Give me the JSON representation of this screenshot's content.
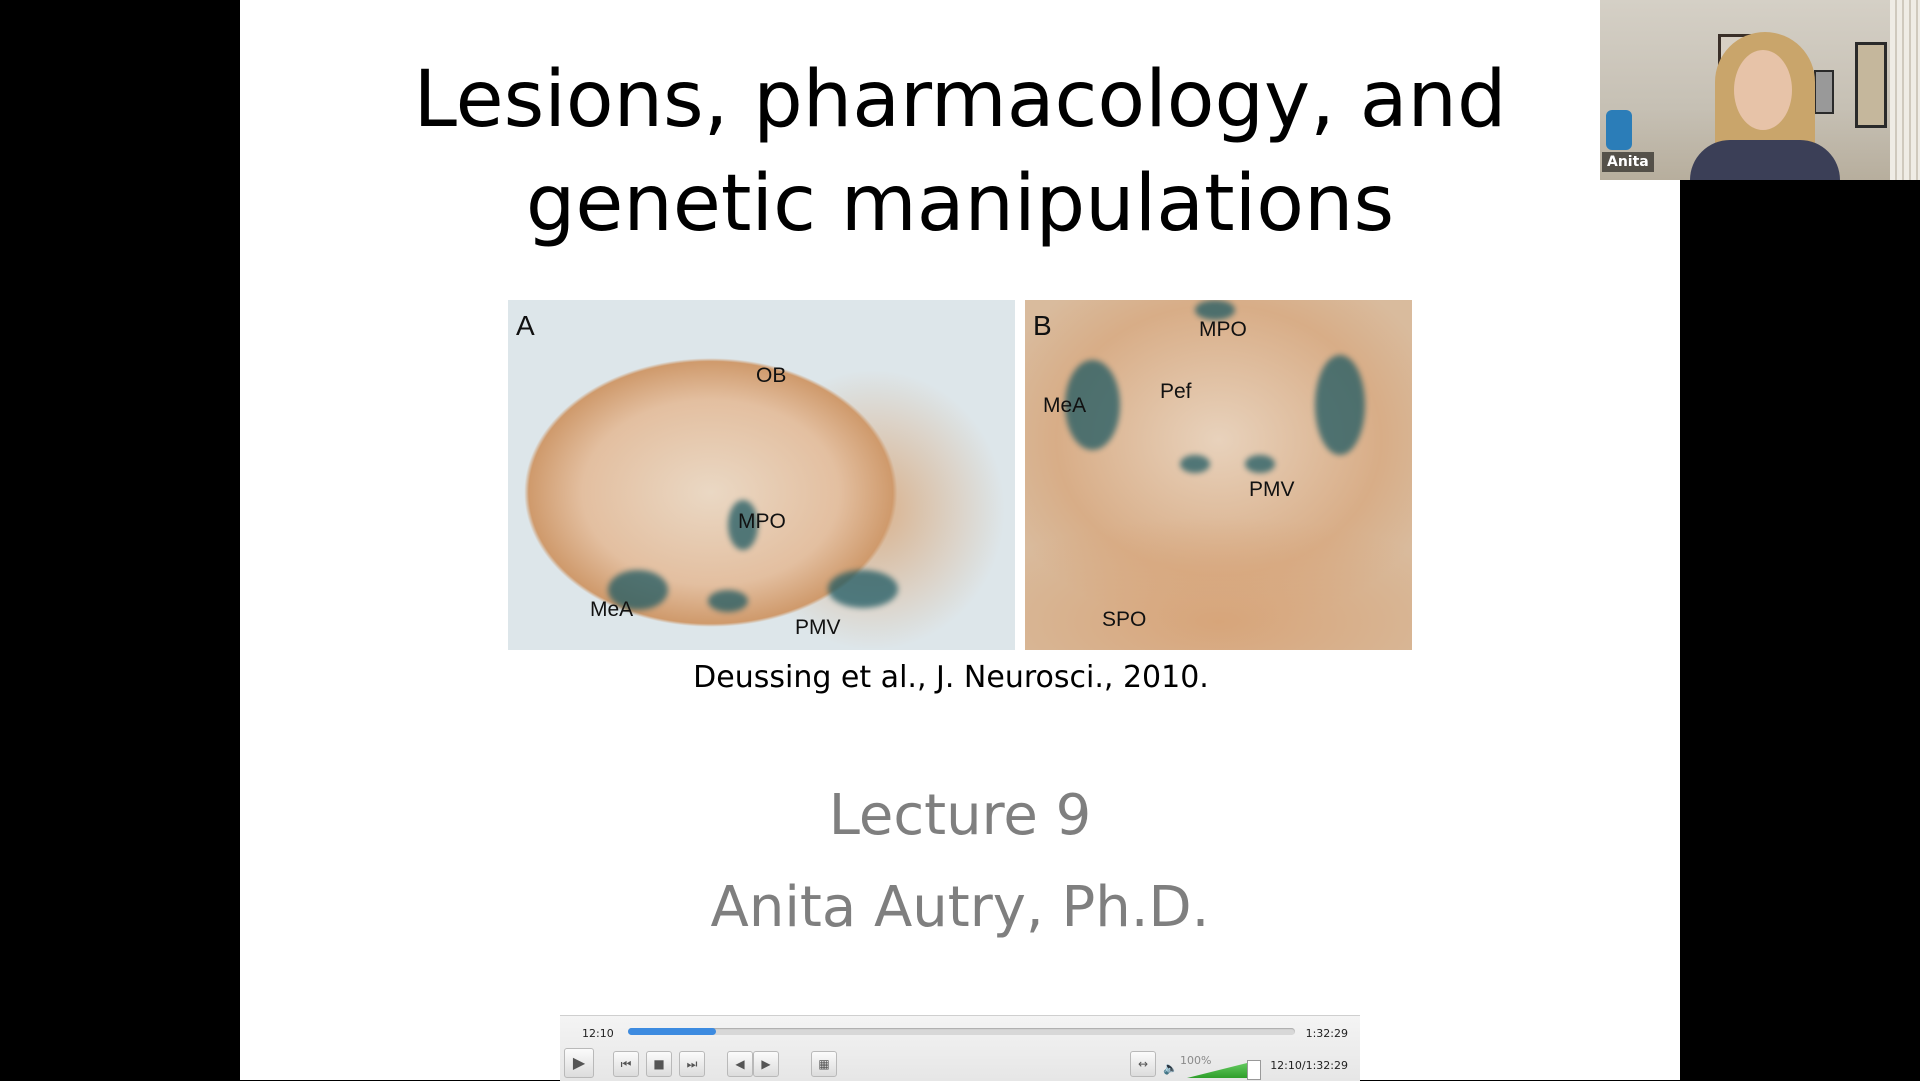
{
  "slide": {
    "title_line1": "Lesions, pharmacology, and",
    "title_line2": "genetic manipulations",
    "citation": "Deussing et al., J. Neurosci., 2010.",
    "lecture": "Lecture 9",
    "author": "Anita Autry, Ph.D."
  },
  "figure": {
    "panel_a": {
      "letter": "A",
      "labels": {
        "ob": "OB",
        "mpo": "MPO",
        "mea": "MeA",
        "pmv": "PMV"
      }
    },
    "panel_b": {
      "letter": "B",
      "labels": {
        "mpo": "MPO",
        "mea": "MeA",
        "pef": "Pef",
        "pmv": "PMV",
        "spo": "SPO"
      }
    }
  },
  "webcam": {
    "participant_name": "Anita"
  },
  "player": {
    "current_time": "12:10",
    "total_time": "1:32:29",
    "progress": 0.132,
    "volume_label": "100%",
    "volume": 1.0,
    "time_combined": "12:10/1:32:29",
    "icons": {
      "play": "play-icon",
      "prev": "skip-back-icon",
      "stop": "stop-icon",
      "next": "skip-forward-icon",
      "frame_prev": "frame-back-icon",
      "frame_next": "frame-forward-icon",
      "fullscreen": "fullscreen-icon",
      "fit": "fit-width-icon",
      "speaker": "speaker-icon"
    },
    "accent_color": "#3d8be0",
    "volume_color": "#2e9e2a"
  }
}
